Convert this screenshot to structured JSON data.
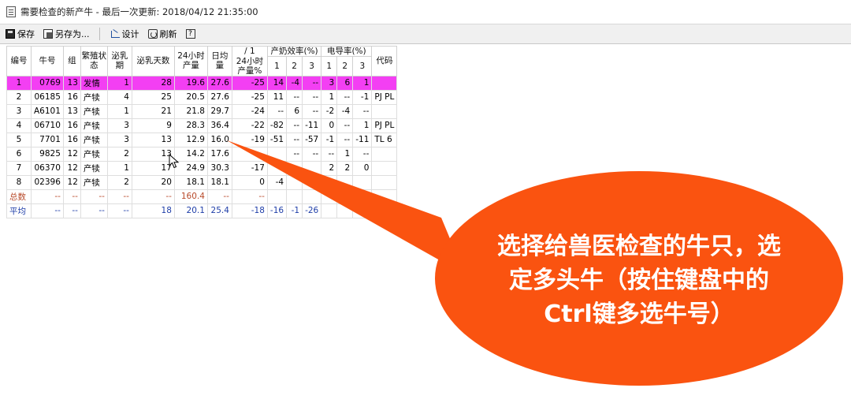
{
  "window": {
    "title": "需要检查的新产牛 - 最后一次更新: 2018/04/12 21:35:00"
  },
  "toolbar": {
    "save": "保存",
    "save_as": "另存为...",
    "design": "设计",
    "refresh": "刷新",
    "help": "?"
  },
  "grid": {
    "headers": {
      "col_no": "编号",
      "col_cow": "牛号",
      "col_group": "组",
      "col_repro": "繁殖状态",
      "col_lact": "泌乳期",
      "col_dim": "泌乳天数",
      "col_24h": "24小时产量",
      "col_daily": "日均量",
      "col_24h_pct": "24小时产量%",
      "col_24h_pct_top": "/ 1",
      "group_eff": "产奶效率(%)",
      "group_cond": "电导率(%)",
      "sub_1": "1",
      "sub_2": "2",
      "sub_3": "3",
      "col_code": "代码"
    },
    "rows": [
      {
        "no": "1",
        "cow": "0769",
        "group": "13",
        "state": "发情",
        "lact": "1",
        "dim": "28",
        "y24": "19.6",
        "avg": "27.6",
        "pct": "-25",
        "e1": "14",
        "e2": "-4",
        "e3": "--",
        "k1": "3",
        "k2": "6",
        "k3": "1",
        "code": ""
      },
      {
        "no": "2",
        "cow": "06185",
        "group": "16",
        "state": "产犊",
        "lact": "4",
        "dim": "25",
        "y24": "20.5",
        "avg": "27.6",
        "pct": "-25",
        "e1": "11",
        "e2": "--",
        "e3": "--",
        "k1": "1",
        "k2": "--",
        "k3": "-1",
        "code": "PJ PL"
      },
      {
        "no": "3",
        "cow": "A6101",
        "group": "13",
        "state": "产犊",
        "lact": "1",
        "dim": "21",
        "y24": "21.8",
        "avg": "29.7",
        "pct": "-24",
        "e1": "--",
        "e2": "6",
        "e3": "--",
        "k1": "-2",
        "k2": "-4",
        "k3": "--",
        "code": ""
      },
      {
        "no": "4",
        "cow": "06710",
        "group": "16",
        "state": "产犊",
        "lact": "3",
        "dim": "9",
        "y24": "28.3",
        "avg": "36.4",
        "pct": "-22",
        "e1": "-82",
        "e2": "--",
        "e3": "-11",
        "k1": "0",
        "k2": "--",
        "k3": "1",
        "code": "PJ PL"
      },
      {
        "no": "5",
        "cow": "7701",
        "group": "16",
        "state": "产犊",
        "lact": "3",
        "dim": "13",
        "y24": "12.9",
        "avg": "16.0",
        "pct": "-19",
        "e1": "-51",
        "e2": "--",
        "e3": "-57",
        "k1": "-1",
        "k2": "--",
        "k3": "-11",
        "code": "TL 6"
      },
      {
        "no": "6",
        "cow": "9825",
        "group": "12",
        "state": "产犊",
        "lact": "2",
        "dim": "13",
        "y24": "14.2",
        "avg": "17.6",
        "pct": "",
        "e1": "",
        "e2": "--",
        "e3": "--",
        "k1": "--",
        "k2": "1",
        "k3": "--",
        "code": ""
      },
      {
        "no": "7",
        "cow": "06370",
        "group": "12",
        "state": "产犊",
        "lact": "1",
        "dim": "17",
        "y24": "24.9",
        "avg": "30.3",
        "pct": "-17",
        "e1": "",
        "e2": "",
        "e3": "",
        "k1": "2",
        "k2": "2",
        "k3": "0",
        "code": ""
      },
      {
        "no": "8",
        "cow": "02396",
        "group": "12",
        "state": "产犊",
        "lact": "2",
        "dim": "20",
        "y24": "18.1",
        "avg": "18.1",
        "pct": "0",
        "e1": "-4",
        "e2": "",
        "e3": "",
        "k1": "",
        "k2": "",
        "k3": "",
        "code": ""
      }
    ],
    "total": {
      "label": "总数",
      "cow": "--",
      "group": "--",
      "state": "--",
      "lact": "--",
      "dim": "--",
      "y24": "160.4",
      "avg": "--",
      "pct": "--"
    },
    "average": {
      "label": "平均",
      "cow": "--",
      "group": "--",
      "state": "--",
      "lact": "--",
      "dim": "18",
      "y24": "20.1",
      "avg": "25.4",
      "pct": "-18",
      "e1": "-16",
      "e2": "-1",
      "e3": "-26"
    }
  },
  "callout": {
    "text": "选择给兽医检查的牛只，选定多头牛（按住键盘中的Ctrl键多选牛号）",
    "color": "#fa5310"
  }
}
